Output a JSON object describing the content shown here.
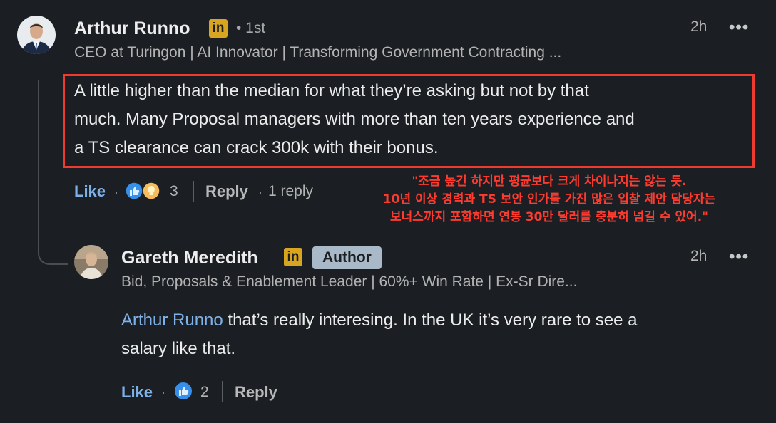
{
  "comment": {
    "author": "Arthur Runno",
    "linkedin_badge": "in",
    "degree": "• 1st",
    "headline": "CEO at Turingon | AI Innovator | Transforming Government Contracting ...",
    "time": "2h",
    "more": "•••",
    "text_lines": [
      "A little higher than the median for what they’re asking but not by that",
      "much. Many Proposal managers with more than ten years experience and",
      "a TS clearance can crack 300k with their bonus."
    ],
    "like_label": "Like",
    "reaction_count": "3",
    "reply_label": "Reply",
    "replies_label": "1 reply"
  },
  "annotation": {
    "lines": [
      "\"조금 높긴 하지만 평균보다 크게 차이나지는 않는 듯.",
      "10년 이상 경력과 TS 보안 인가를 가진 많은 입찰 제안 담당자는",
      "보너스까지 포함하면 연봉 30만 달러를 충분히 넘길 수 있어.\""
    ],
    "color": "#ff3b2f"
  },
  "reply": {
    "author": "Gareth Meredith",
    "linkedin_badge": "in",
    "author_badge": "Author",
    "headline": "Bid, Proposals & Enablement Leader | 60%+ Win Rate | Ex-Sr Dire...",
    "time": "2h",
    "more": "•••",
    "mention": "Arthur Runno",
    "text_line1_rest": " that’s really interesing. In the UK it’s very rare to see a",
    "text_line2": "salary like that.",
    "like_label": "Like",
    "reaction_count": "2",
    "reply_label": "Reply"
  },
  "colors": {
    "background": "#1b1f23",
    "link_blue": "#7fb1e9",
    "highlight_red": "#ef3b2f",
    "linkedin_gold": "#d9a521"
  }
}
